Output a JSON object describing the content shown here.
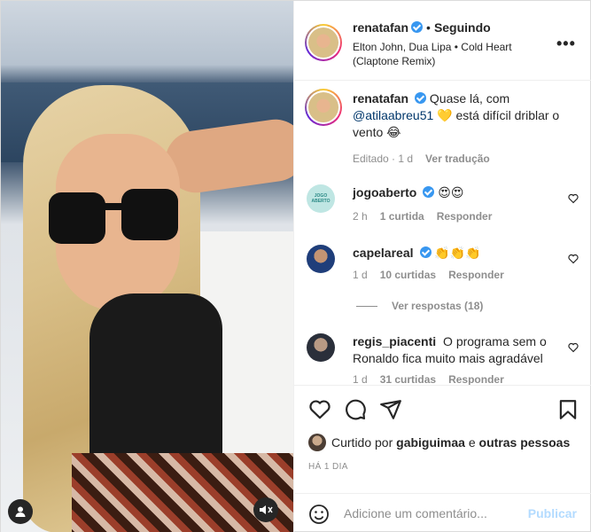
{
  "header": {
    "username": "renatafan",
    "separator": "•",
    "following_label": "Seguindo",
    "song": "Elton John, Dua Lipa • Cold Heart (Claptone Remix)",
    "more": "•••"
  },
  "caption": {
    "username": "renatafan",
    "text_before": "Quase lá, com",
    "mention": "@atilaabreu51",
    "text_after": "💛 está difícil driblar o vento 😂",
    "edited": "Editado · 1 d",
    "translate": "Ver tradução"
  },
  "comments": [
    {
      "username": "jogoaberto",
      "text": "😍😍",
      "time": "2 h",
      "likes": "1 curtida",
      "reply": "Responder",
      "avatar_text": "JOGO ABERTO"
    },
    {
      "username": "capelareal",
      "text": "👏👏👏",
      "time": "1 d",
      "likes": "10 curtidas",
      "reply": "Responder"
    },
    {
      "username": "regis_piacenti",
      "text": "O programa sem o Ronaldo fica muito mais agradável",
      "time": "1 d",
      "likes": "31 curtidas",
      "reply": "Responder"
    }
  ],
  "view_replies": "Ver respostas (18)",
  "liked_by": {
    "prefix": "Curtido por",
    "user": "gabiguimaa",
    "joiner": "e",
    "others": "outras pessoas"
  },
  "time_ago": "HÁ 1 DIA",
  "add_comment": {
    "placeholder": "Adicione um comentário...",
    "publish": "Publicar"
  },
  "icons": {
    "like": "heart-icon",
    "comment": "comment-icon",
    "share": "send-icon",
    "save": "bookmark-icon",
    "emoji": "emoji-icon",
    "mute": "mute-icon",
    "tagged": "user-icon"
  },
  "colors": {
    "verified": "#3897f0",
    "link": "#00376b",
    "publish_disabled": "#b3dbff",
    "muted_text": "#8e8e8e"
  }
}
